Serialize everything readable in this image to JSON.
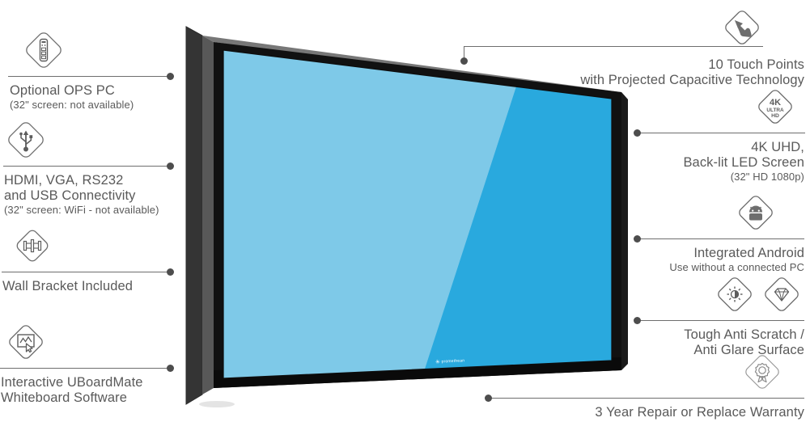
{
  "product": {
    "device_name": "Interactive Touchscreen Display",
    "logo_text": "promethean",
    "logo_mark": "✳",
    "screen_color_light": "#7ec9e8",
    "screen_color_main": "#29a9de",
    "bezel_color": "#111111",
    "frame_color": "#3a3a3a",
    "frame_top_color": "#6b6b6b"
  },
  "style": {
    "line_color": "#6e6e6e",
    "dot_color": "#4d4d4d",
    "text_color": "#5a5a5a",
    "icon_color": "#6e6e6e"
  },
  "callouts_left": [
    {
      "id": "ops-pc",
      "icon": "ops-pc-module-icon",
      "line1": "Optional OPS PC",
      "line2": "",
      "sub": "(32\" screen: not available)"
    },
    {
      "id": "connectivity",
      "icon": "usb-connector-icon",
      "line1": "HDMI, VGA, RS232",
      "line2": "and USB Connectivity",
      "sub": "(32\" screen: WiFi - not available)"
    },
    {
      "id": "wall-bracket",
      "icon": "wall-bracket-icon",
      "line1": "Wall Bracket Included",
      "line2": "",
      "sub": ""
    },
    {
      "id": "whiteboard-software",
      "icon": "whiteboard-software-icon",
      "line1": "Interactive UBoardMate",
      "line2": "Whiteboard Software",
      "sub": ""
    }
  ],
  "callouts_right": [
    {
      "id": "touch-points",
      "icon": "touch-hand-icon",
      "line1": "10 Touch Points",
      "line2": "with Projected Capacitive Technology",
      "sub": ""
    },
    {
      "id": "resolution",
      "icon": "4k-ultra-hd-icon",
      "icon_text": {
        "top": "4K",
        "mid": "ULTRA",
        "bottom": "HD"
      },
      "line1": "4K UHD,",
      "line2": "Back-lit LED Screen",
      "sub": "(32\" HD 1080p)"
    },
    {
      "id": "android",
      "icon": "android-robot-icon",
      "line1": "Integrated Android",
      "line2": "",
      "sub": "Use without a connected PC"
    },
    {
      "id": "surface",
      "icon": "anti-glare-brightness-icon",
      "icon2": "diamond-hardness-icon",
      "line1": "Tough Anti Scratch /",
      "line2": "Anti Glare Surface",
      "sub": ""
    },
    {
      "id": "warranty",
      "icon": "warranty-ribbon-icon",
      "line1": "3 Year Repair or Replace Warranty",
      "line2": "",
      "sub": ""
    }
  ]
}
